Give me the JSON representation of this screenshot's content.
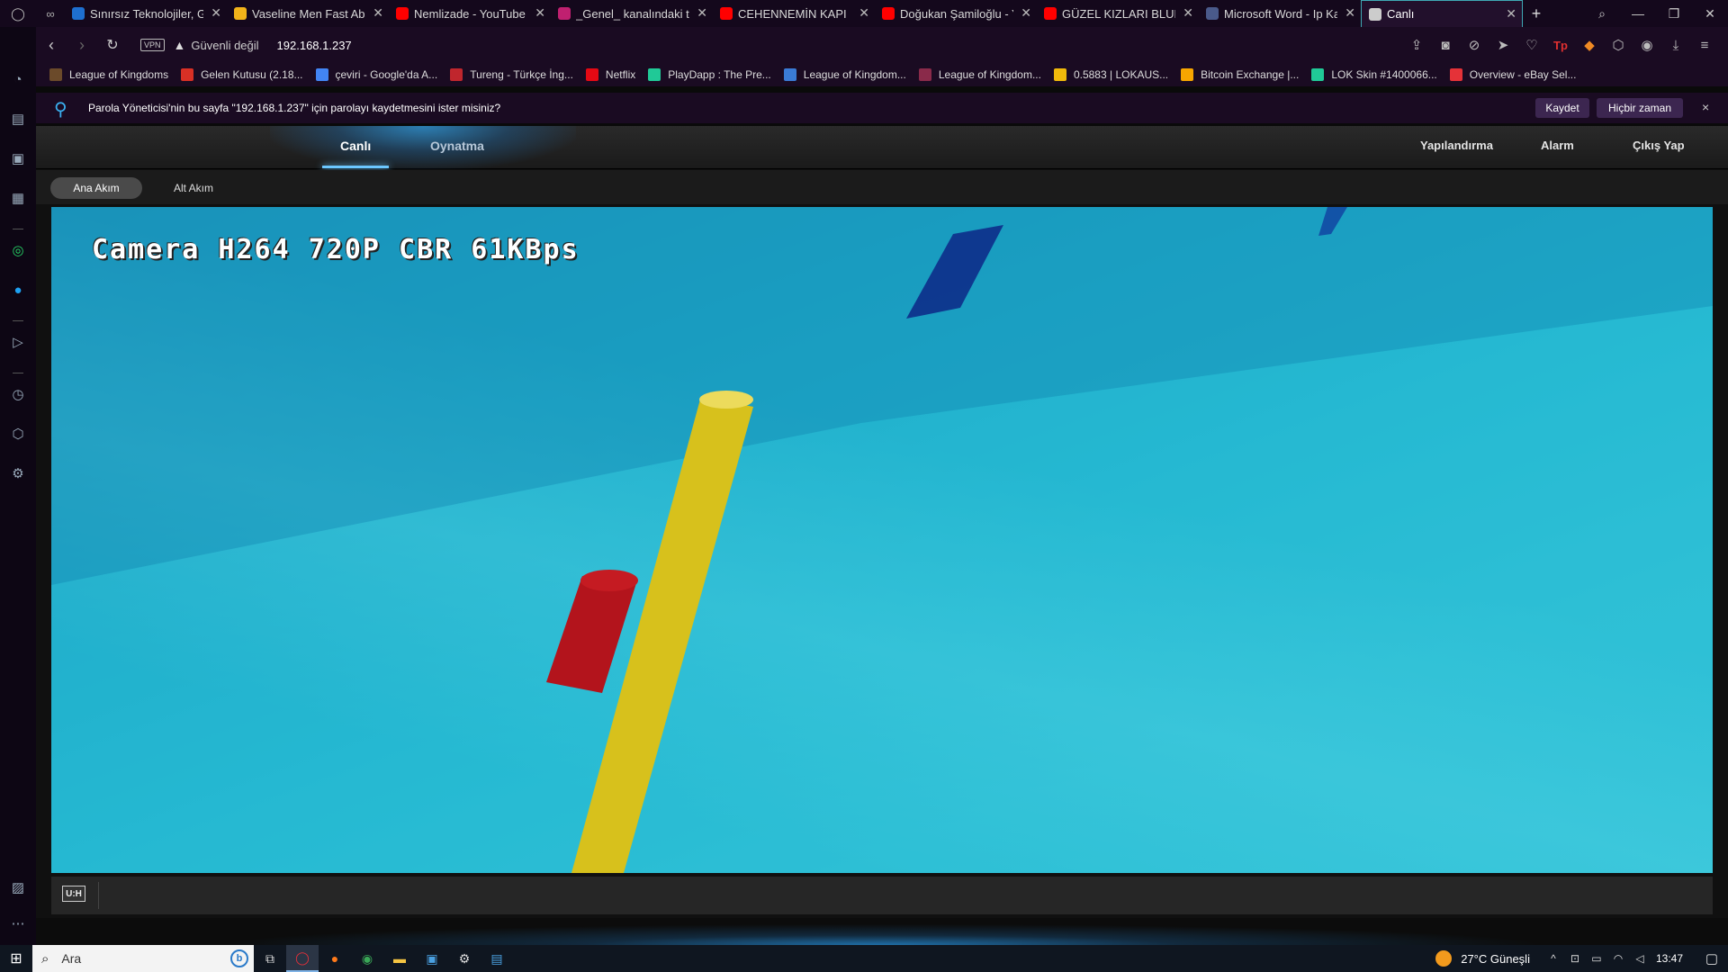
{
  "browser": {
    "tabs": [
      {
        "title": "Sınırsız Teknolojiler, Gü",
        "icon": "triangle-icon",
        "color": "#1e6fd0",
        "active": false
      },
      {
        "title": "Vaseline Men Fast Abso",
        "icon": "walmart-icon",
        "color": "#f2b31a",
        "active": false
      },
      {
        "title": "Nemlizade - YouTube",
        "icon": "youtube-icon",
        "color": "#ff0000",
        "active": false
      },
      {
        "title": "_Genel_ kanalındaki top",
        "icon": "play-icon",
        "color": "#c02070",
        "active": false
      },
      {
        "title": "CEHENNEMİN KAPI",
        "icon": "youtube-icon",
        "color": "#ff0000",
        "active": false
      },
      {
        "title": "Doğukan Şamiloğlu - Yo",
        "icon": "youtube-icon",
        "color": "#ff0000",
        "active": false
      },
      {
        "title": "GÜZEL KIZLARI BLUETO",
        "icon": "youtube-icon",
        "color": "#ff0000",
        "active": false
      },
      {
        "title": "Microsoft Word - Ip Kar",
        "icon": "doc-icon",
        "color": "#4a5a8a",
        "active": false
      },
      {
        "title": "Canlı",
        "icon": "globe-icon",
        "color": "#cccccc",
        "active": true
      }
    ],
    "new_tab": "+",
    "address": {
      "vpn": "VPN",
      "security": "Güvenli değil",
      "url": "192.168.1.237"
    },
    "bookmarks": [
      {
        "label": "League of Kingdoms",
        "color": "#6b4a2a"
      },
      {
        "label": "Gelen Kutusu (2.18...",
        "color": "#d93025"
      },
      {
        "label": "çeviri - Google'da A...",
        "color": "#4285f4"
      },
      {
        "label": "Tureng - Türkçe İng...",
        "color": "#c0262d"
      },
      {
        "label": "Netflix",
        "color": "#e50914"
      },
      {
        "label": "PlayDapp : The Pre...",
        "color": "#20c997"
      },
      {
        "label": "League of Kingdom...",
        "color": "#3a7bd5"
      },
      {
        "label": "League of Kingdom...",
        "color": "#8a2a4a"
      },
      {
        "label": "0.5883 | LOKAUS...",
        "color": "#f0b90b"
      },
      {
        "label": "Bitcoin Exchange |...",
        "color": "#f7a600"
      },
      {
        "label": "LOK Skin #1400066...",
        "color": "#20c997"
      },
      {
        "label": "Overview - eBay Sel...",
        "color": "#e53238"
      }
    ],
    "password_prompt": {
      "message": "Parola Yöneticisi'nin bu sayfa \"192.168.1.237\" için parolayı kaydetmesini ister misiniz?",
      "save": "Kaydet",
      "never": "Hiçbir zaman",
      "close": "×"
    }
  },
  "camera_page": {
    "nav": {
      "live": "Canlı",
      "playback": "Oynatma",
      "config": "Yapılandırma",
      "alarm": "Alarm",
      "logout": "Çıkış Yap"
    },
    "streams": {
      "main": "Ana Akım",
      "sub": "Alt Akım"
    },
    "video": {
      "osd": "Camera H264 720P CBR 61KBps"
    },
    "controls": {
      "hd_button": "U:H"
    }
  },
  "taskbar": {
    "search_placeholder": "Ara",
    "weather": "27°C  Güneşli",
    "time": "13:47"
  }
}
